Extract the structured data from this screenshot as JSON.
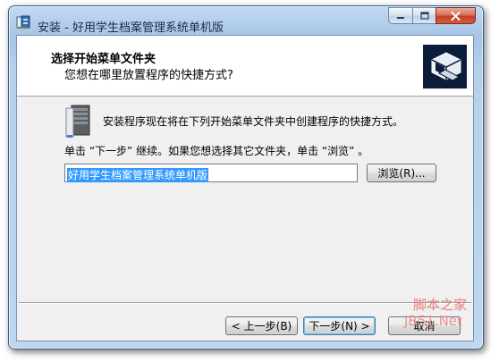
{
  "window": {
    "title": "安装 - 好用学生档案管理系统单机版"
  },
  "header": {
    "title": "选择开始菜单文件夹",
    "subtitle": "您想在哪里放置程序的快捷方式?"
  },
  "body": {
    "info_text": "安装程序现在将在下列开始菜单文件夹中创建程序的快捷方式。",
    "instruction_text": "单击 “下一步” 继续。如果您想选择其它文件夹，单击 “浏览” 。",
    "folder_value": "好用学生档案管理系统单机版",
    "browse_label": "浏览(R)..."
  },
  "footer": {
    "back_label": "< 上一步(B)",
    "next_label": "下一步(N) >",
    "cancel_label": "取消"
  },
  "watermark": {
    "line1": "脚本之家",
    "line2": "JB51.Net"
  },
  "icons": {
    "app": "setup-app-icon",
    "logo": "installer-computer-icon",
    "folder": "start-menu-folder-icon"
  },
  "colors": {
    "selection": "#3399ff",
    "titlebar": "#b6d0ec",
    "close_button": "#c43f27"
  }
}
